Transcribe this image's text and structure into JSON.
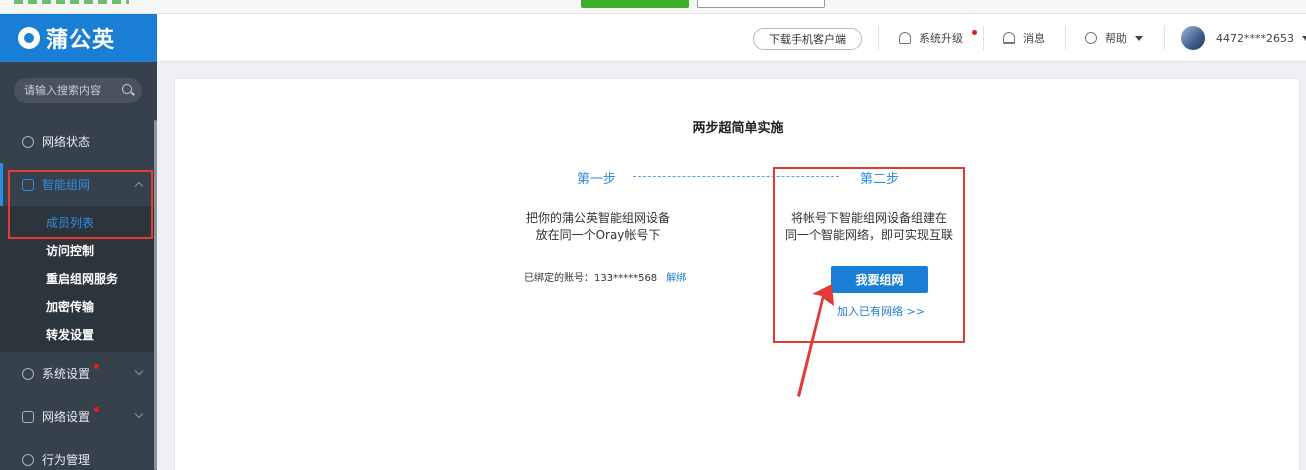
{
  "sidebar": {
    "logo_text": "蒲公英",
    "search_placeholder": "请输入搜索内容",
    "items": [
      {
        "label": "网络状态"
      },
      {
        "label": "智能组网"
      },
      {
        "label": "系统设置"
      },
      {
        "label": "网络设置"
      },
      {
        "label": "行为管理"
      }
    ],
    "sub_items": [
      {
        "label": "成员列表"
      },
      {
        "label": "访问控制"
      },
      {
        "label": "重启组网服务"
      },
      {
        "label": "加密传输"
      },
      {
        "label": "转发设置"
      }
    ]
  },
  "header": {
    "download_label": "下载手机客户端",
    "upgrade_label": "系统升级",
    "messages_label": "消息",
    "help_label": "帮助",
    "account": "4472****2653"
  },
  "main": {
    "title": "两步超简单实施",
    "step1_label": "第一步",
    "step2_label": "第二步",
    "step1_desc_line1": "把你的蒲公英智能组网设备",
    "step1_desc_line2": "放在同一个Oray帐号下",
    "bound_label": "已绑定的账号：133*****568",
    "unbind_label": "解绑",
    "step2_desc_line1": "将帐号下智能组网设备组建在",
    "step2_desc_line2": "同一个智能网络，即可实现互联",
    "create_button": "我要组网",
    "join_link": "加入已有网络 >>"
  },
  "colors": {
    "brand": "#1a7fd4",
    "sidebar_bg": "#37414b",
    "annotation_red": "#e53935",
    "notify_dot": "#e51c23"
  }
}
